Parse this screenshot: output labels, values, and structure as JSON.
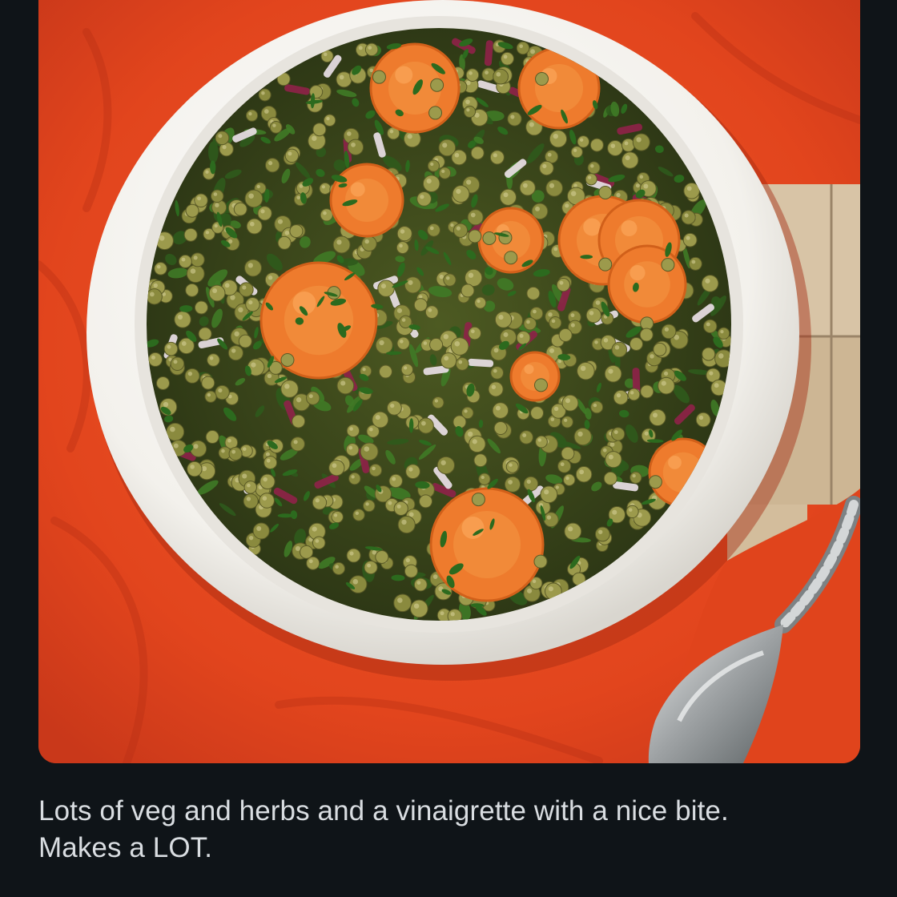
{
  "post": {
    "image": {
      "subject_icon": "lentil-salad-photo",
      "colors": {
        "background": "#0f1418",
        "cloth": "#e2451d",
        "bowl": "#f3f1ec",
        "carrot": "#ee7b2d",
        "lentil": "#9c9a4c",
        "herb": "#2f5a1c",
        "radicchio": "#8d2348",
        "tile": "#d8c4a6",
        "spoon": "#b9bcbd"
      }
    },
    "caption": {
      "line1": "Lots of veg and herbs and a vinaigrette with a nice bite.",
      "line2": "Makes a LOT."
    }
  }
}
